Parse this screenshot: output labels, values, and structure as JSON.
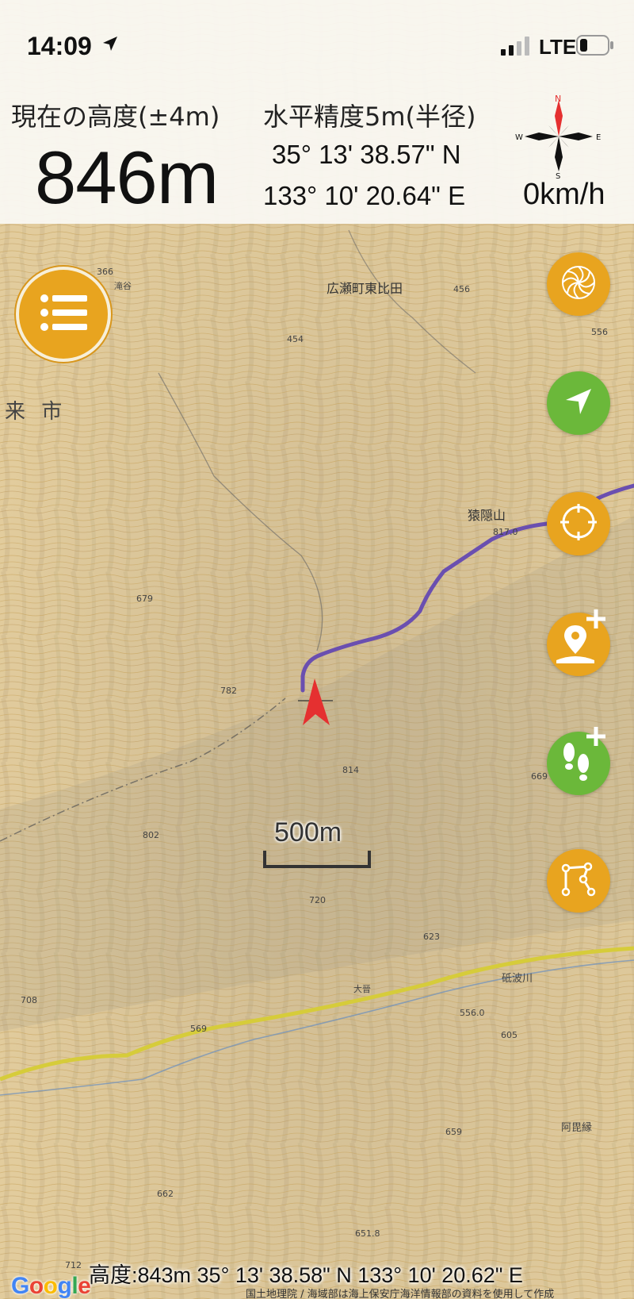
{
  "status_bar": {
    "time": "14:09",
    "network": "LTE"
  },
  "header": {
    "altitude_label": "現在の高度(±4m)",
    "altitude_value": "846m",
    "accuracy_label": "水平精度5m(半径)",
    "latitude": "35° 13' 38.57\" N",
    "longitude": "133° 10' 20.64\" E",
    "speed": "0km/h",
    "compass": {
      "n": "N",
      "e": "E",
      "s": "S",
      "w": "W"
    }
  },
  "map": {
    "labels": {
      "town": "広瀬町東比田",
      "city_fragment": "来 市",
      "mountain": "猿隠山",
      "place_takitani": "滝谷",
      "place_ooba": "大晉",
      "river": "砥波川",
      "place_abi": "阿毘縁",
      "elev_366": "366",
      "elev_456": "456",
      "elev_454": "454",
      "elev_556": "556",
      "elev_679": "679",
      "elev_782": "782",
      "elev_814": "814",
      "elev_669": "669",
      "elev_802": "802",
      "elev_720": "720",
      "elev_623": "623",
      "elev_708": "708",
      "elev_569": "569",
      "elev_556b": "556.0",
      "elev_605": "605",
      "elev_659": "659",
      "elev_662": "662",
      "elev_651": "651.8",
      "elev_712": "712",
      "elev_817": "817.0"
    },
    "scale": "500m"
  },
  "buttons": {
    "menu": "menu-icon",
    "layers": "aperture-icon",
    "navigate": "navigation-arrow-icon",
    "center": "crosshair-icon",
    "add_point": "add-location-icon",
    "add_track": "add-footsteps-icon",
    "route": "route-icon"
  },
  "colors": {
    "orange": "#e8a41f",
    "green": "#6bb83a",
    "track": "#6a4fb0",
    "marker": "#e53030"
  },
  "bottom": {
    "readout": "高度:843m  35° 13' 38.58\" N 133° 10' 20.62\" E",
    "logo": "Google",
    "attribution": "国土地理院 / 海域部は海上保安庁海洋情報部の資料を使用して作成"
  }
}
